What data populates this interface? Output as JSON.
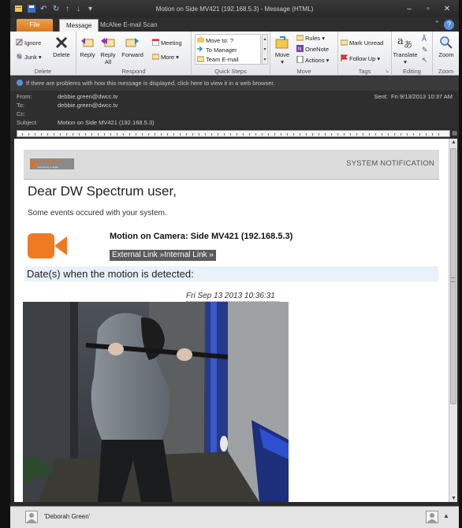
{
  "window": {
    "title": "Motion on Side MV421 (192.168.5.3)  -  Message (HTML)"
  },
  "quick_access": {
    "save_icon": "save-icon",
    "undo_icon": "undo-icon",
    "redo_icon": "redo-icon"
  },
  "window_controls": {
    "minimize": "–",
    "restore": "▫",
    "close": "✕"
  },
  "tabs": [
    {
      "label": "File"
    },
    {
      "label": "Message"
    },
    {
      "label": "McAfee E-mail Scan"
    }
  ],
  "ribbon": {
    "delete_group": {
      "label": "Delete",
      "ignore": "Ignore",
      "junk": "Junk ▾",
      "delete": "Delete"
    },
    "respond_group": {
      "label": "Respond",
      "reply": "Reply",
      "reply_all_1": "Reply",
      "reply_all_2": "All",
      "forward": "Forward",
      "meeting": "Meeting",
      "more": "More ▾"
    },
    "quick_steps_group": {
      "label": "Quick Steps",
      "items": [
        "Move to: ?",
        "To Manager",
        "Team E-mail"
      ]
    },
    "move_group": {
      "label": "Move",
      "move": "Move",
      "move_sub": "▾",
      "rules": "Rules ▾",
      "onenote": "OneNote",
      "actions": "Actions ▾"
    },
    "tags_group": {
      "label": "Tags",
      "mark_unread": "Mark Unread",
      "follow_up": "Follow Up ▾"
    },
    "editing_group": {
      "label": "Editing",
      "translate": "Translate",
      "translate_sub": "▾"
    },
    "zoom_group": {
      "label": "Zoom",
      "zoom": "Zoom"
    }
  },
  "infobar": {
    "text": "If there are problems with how this message is displayed, click here to view it in a web browser."
  },
  "header": {
    "from_label": "From:",
    "from": "debbie.green@dwcc.tv",
    "to_label": "To:",
    "to": "debbie.green@dwcc.tv",
    "cc_label": "Cc:",
    "cc": "",
    "subject_label": "Subject:",
    "subject": "Motion on Side MV421 (192.168.5.3)",
    "sent_label": "Sent:",
    "sent": "Fri 9/13/2013 10:37 AM"
  },
  "email": {
    "logo_text": "DIGITAL",
    "logo_sub": "Everything is digital",
    "system_notification": "SYSTEM NOTIFICATION",
    "greeting": "Dear DW Spectrum user,",
    "events_text": "Some events occured with your system.",
    "motion_title": "Motion on Camera: Side MV421 (192.168.5.3)",
    "links": "External Link »Internal Link »",
    "dates_label": "Date(s) when the motion is detected:",
    "timestamp": "Fri Sep 13 2013 10:36:31",
    "camera_icon": "video-camera-icon"
  },
  "statusbar": {
    "person": "'Deborah Green'"
  },
  "colors": {
    "accent_orange": "#F07A22",
    "file_tab": "#E8892E",
    "dark_chrome": "#2E2E2E",
    "dates_band": "#E9F1FA"
  }
}
